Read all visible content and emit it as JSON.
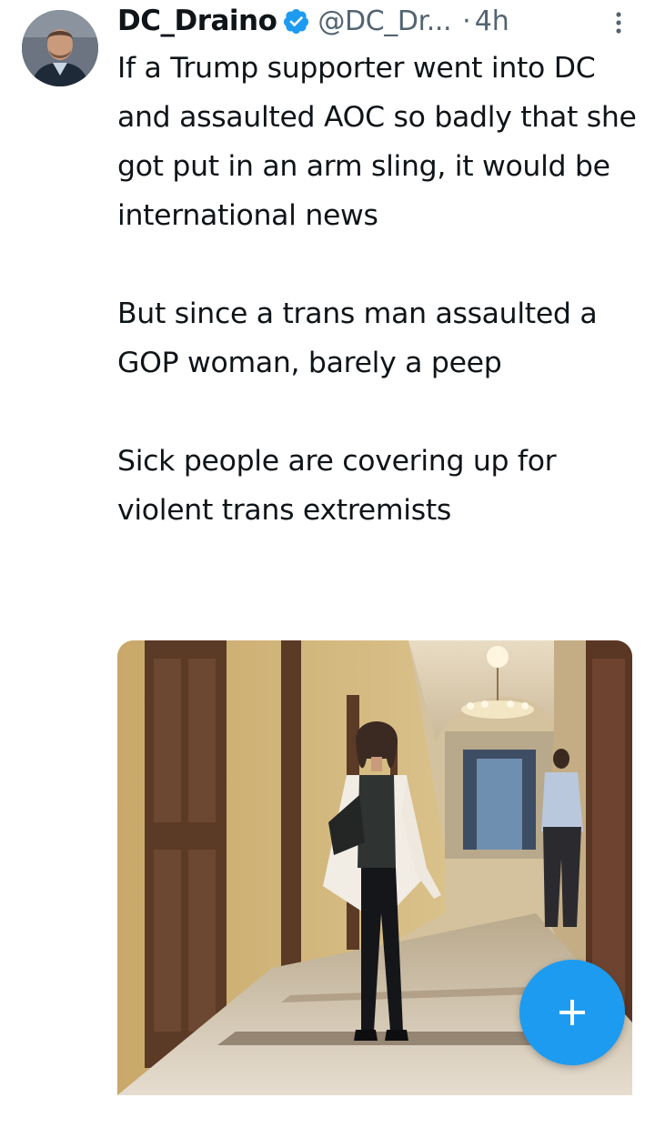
{
  "tweet": {
    "display_name": "DC_Draino",
    "handle": "@DC_Dr...",
    "separator": "·",
    "time": "4h",
    "paragraphs": [
      "If a Trump supporter went into DC and assaulted AOC so badly that she got put in an arm sling, it would be international news",
      "But since a trans man assaulted a GOP woman, barely a peep",
      "Sick people are covering up for violent trans extremists"
    ],
    "media_description": "photo-woman-walking-in-hallway"
  },
  "icons": {
    "verified": "verified-badge-icon",
    "more": "more-vertical-icon",
    "compose": "plus-icon"
  },
  "colors": {
    "accent": "#1d9bf0",
    "text": "#0f1419",
    "secondary": "#536471"
  }
}
